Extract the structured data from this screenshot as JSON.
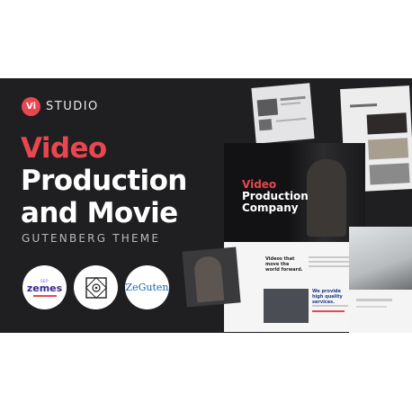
{
  "brand": {
    "badge": "Vi",
    "name": "STUDIO"
  },
  "headline": {
    "line1": "Video",
    "line2": "Production",
    "line3": "and Movie"
  },
  "subtitle": "GUTENBERG THEME",
  "partners": {
    "zemes": {
      "top": "SEP",
      "word": "zemes"
    },
    "seal_icon": "ornamental-seal-icon",
    "zeguten": "ZeGuten"
  },
  "mockups": {
    "title_red": "Video",
    "title_white_1": "Production",
    "title_white_2": "Company",
    "section_heading": "Videos that move the world forward.",
    "services_heading": "We provide high quality services."
  },
  "colors": {
    "accent": "#e8474f",
    "banner_bg": "#1f1f21",
    "text_white": "#ffffff",
    "subtitle": "#b9b9bd"
  }
}
